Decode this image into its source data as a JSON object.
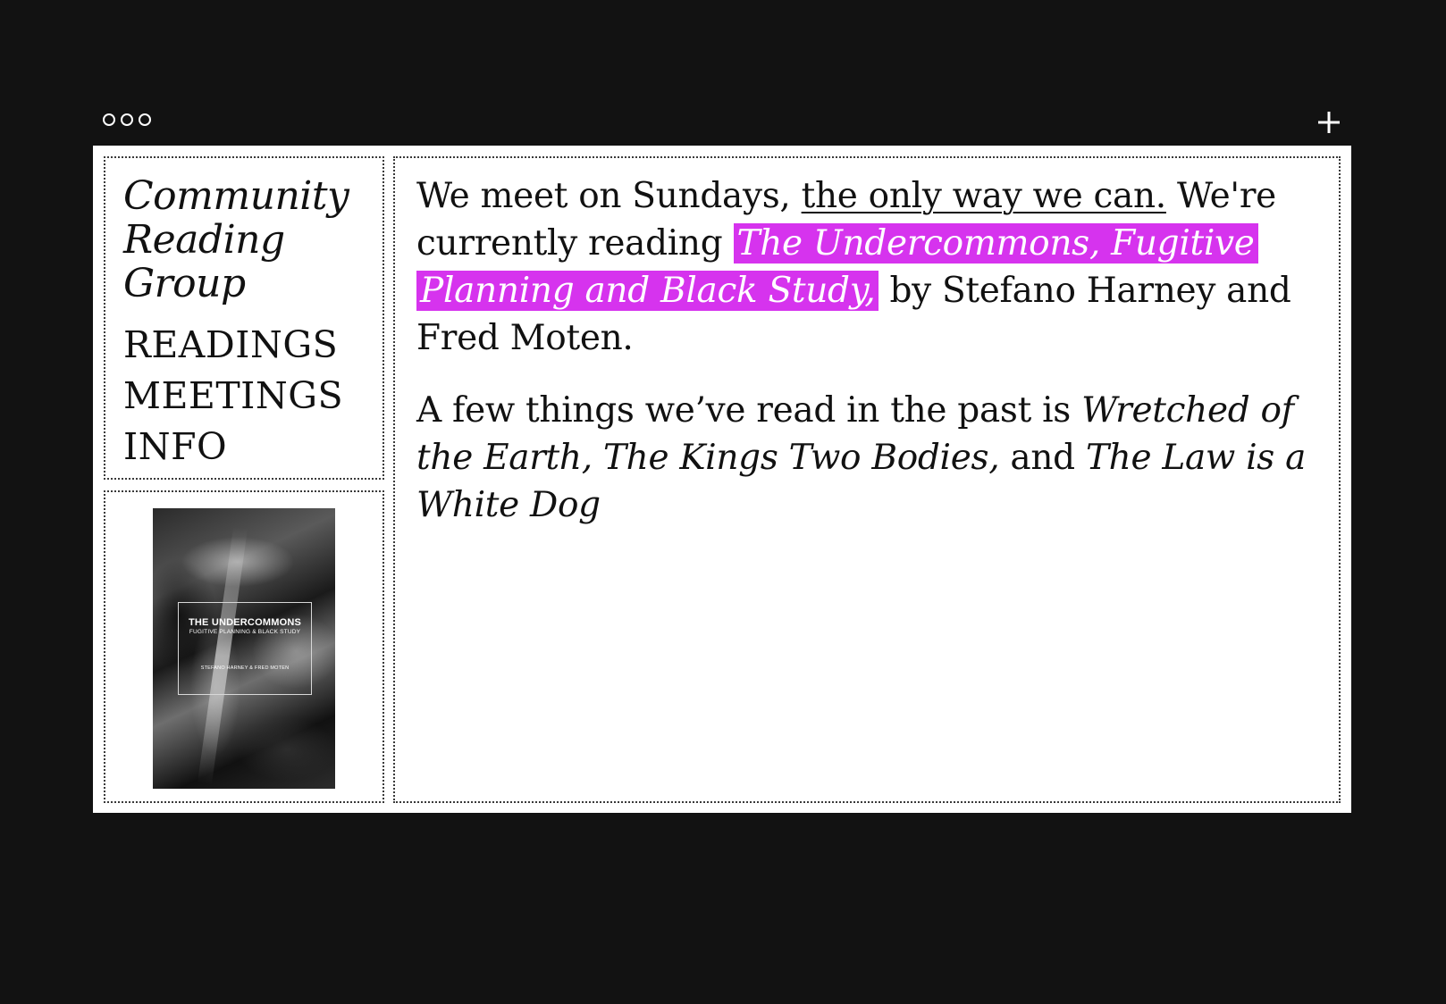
{
  "window": {
    "controls": [
      "dot",
      "dot",
      "dot"
    ],
    "new_tab_icon": "plus-icon"
  },
  "sidebar": {
    "title": "Community Reading Group",
    "title_lines": [
      "Community",
      "Reading",
      "Group"
    ],
    "nav_items": [
      {
        "label": "READINGS"
      },
      {
        "label": "MEETINGS"
      },
      {
        "label": "INFO"
      }
    ]
  },
  "cover": {
    "title": "THE UNDERCOMMONS",
    "subtitle": "FUGITIVE PLANNING & BLACK STUDY",
    "authors": "STEFANO HARNEY & FRED MOTEN"
  },
  "main": {
    "para1": {
      "prefix": "We meet on Sundays, ",
      "link": "the only way we can.",
      "middle": " We're currently reading ",
      "current_book": "The Undercommons, Fugitive Planning and Black Study,",
      "suffix": " by Stefano Harney and Fred Moten."
    },
    "para2": {
      "prefix": "A few things we’ve read in the past is ",
      "book1": "Wretched of the Earth,",
      "sep1": " ",
      "book2": "The Kings Two Bodies,",
      "sep2": " and ",
      "book3": "The Law is a White Dog"
    }
  },
  "colors": {
    "background": "#121212",
    "highlight": "#d633ee",
    "panel": "#ffffff"
  }
}
